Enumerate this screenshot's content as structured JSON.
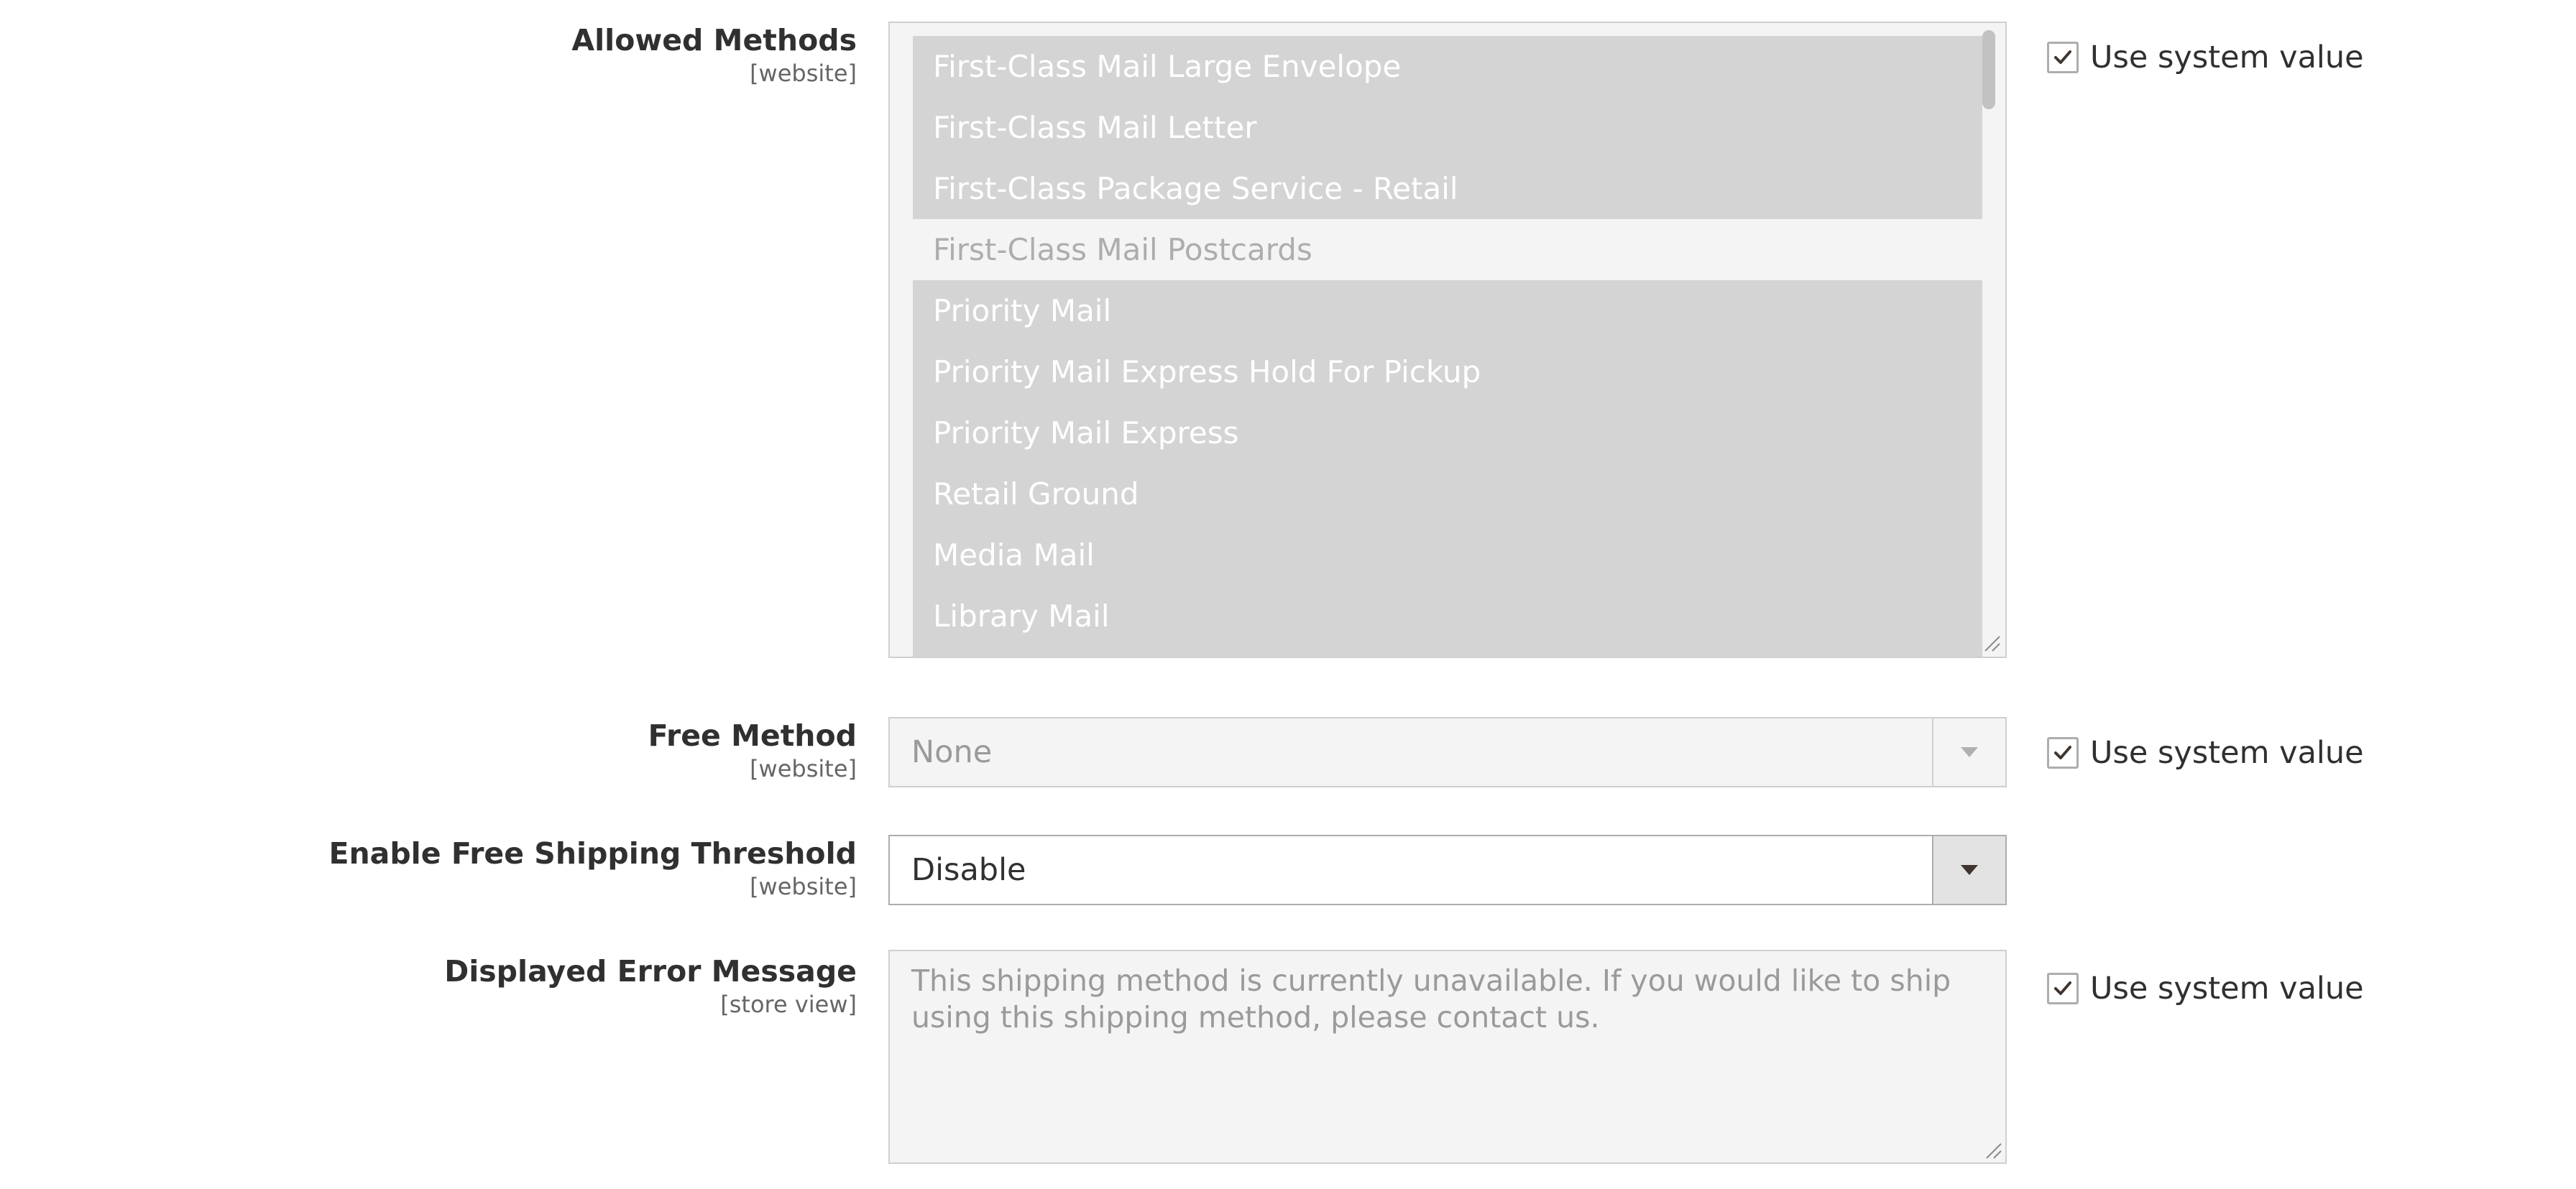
{
  "allowed_methods": {
    "label": "Allowed Methods",
    "scope": "[website]",
    "options": [
      {
        "label": "First-Class Mail Large Envelope",
        "selected": true
      },
      {
        "label": "First-Class Mail Letter",
        "selected": true
      },
      {
        "label": "First-Class Package Service - Retail",
        "selected": true
      },
      {
        "label": "First-Class Mail Postcards",
        "selected": false
      },
      {
        "label": "Priority Mail",
        "selected": true
      },
      {
        "label": "Priority Mail Express Hold For Pickup",
        "selected": true
      },
      {
        "label": "Priority Mail Express",
        "selected": true
      },
      {
        "label": "Retail Ground",
        "selected": true
      },
      {
        "label": "Media Mail",
        "selected": true
      },
      {
        "label": "Library Mail",
        "selected": true
      }
    ],
    "use_system_value": "Use system value"
  },
  "free_method": {
    "label": "Free Method",
    "scope": "[website]",
    "value": "None",
    "use_system_value": "Use system value"
  },
  "free_shipping_threshold": {
    "label": "Enable Free Shipping Threshold",
    "scope": "[website]",
    "value": "Disable"
  },
  "error_message": {
    "label": "Displayed Error Message",
    "scope": "[store view]",
    "value": "This shipping method is currently unavailable. If you would like to ship using this shipping method, please contact us.",
    "use_system_value": "Use system value"
  },
  "colors": {
    "selected_option_bg": "#d4d4d4",
    "disabled_field_bg": "#f4f4f4",
    "text": "#303030"
  }
}
